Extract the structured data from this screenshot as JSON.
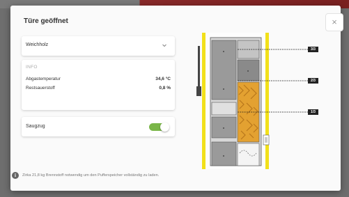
{
  "modal": {
    "title": "Türe geöffnet",
    "close_label": "×"
  },
  "fuel_select": {
    "value": "Weichholz"
  },
  "info": {
    "heading": "INFO",
    "rows": [
      {
        "label": "Abgastemperatur",
        "value": "34,6 °C"
      },
      {
        "label": "Restsauerstoff",
        "value": "0,8 %"
      }
    ]
  },
  "draft": {
    "label": "Saugzug",
    "enabled": true
  },
  "buffer_levels": [
    "3/3",
    "2/3",
    "1/3"
  ],
  "footer": {
    "text": "Zirka 21,8 kg Brennstoff notwendig um den Pufferspeicher vollständig zu laden."
  },
  "colors": {
    "toggle_on": "#7ab648",
    "frame_yellow": "#f2e01a",
    "fuel_orange": "#e3a131",
    "chamber_gray": "#9a9a9a"
  }
}
